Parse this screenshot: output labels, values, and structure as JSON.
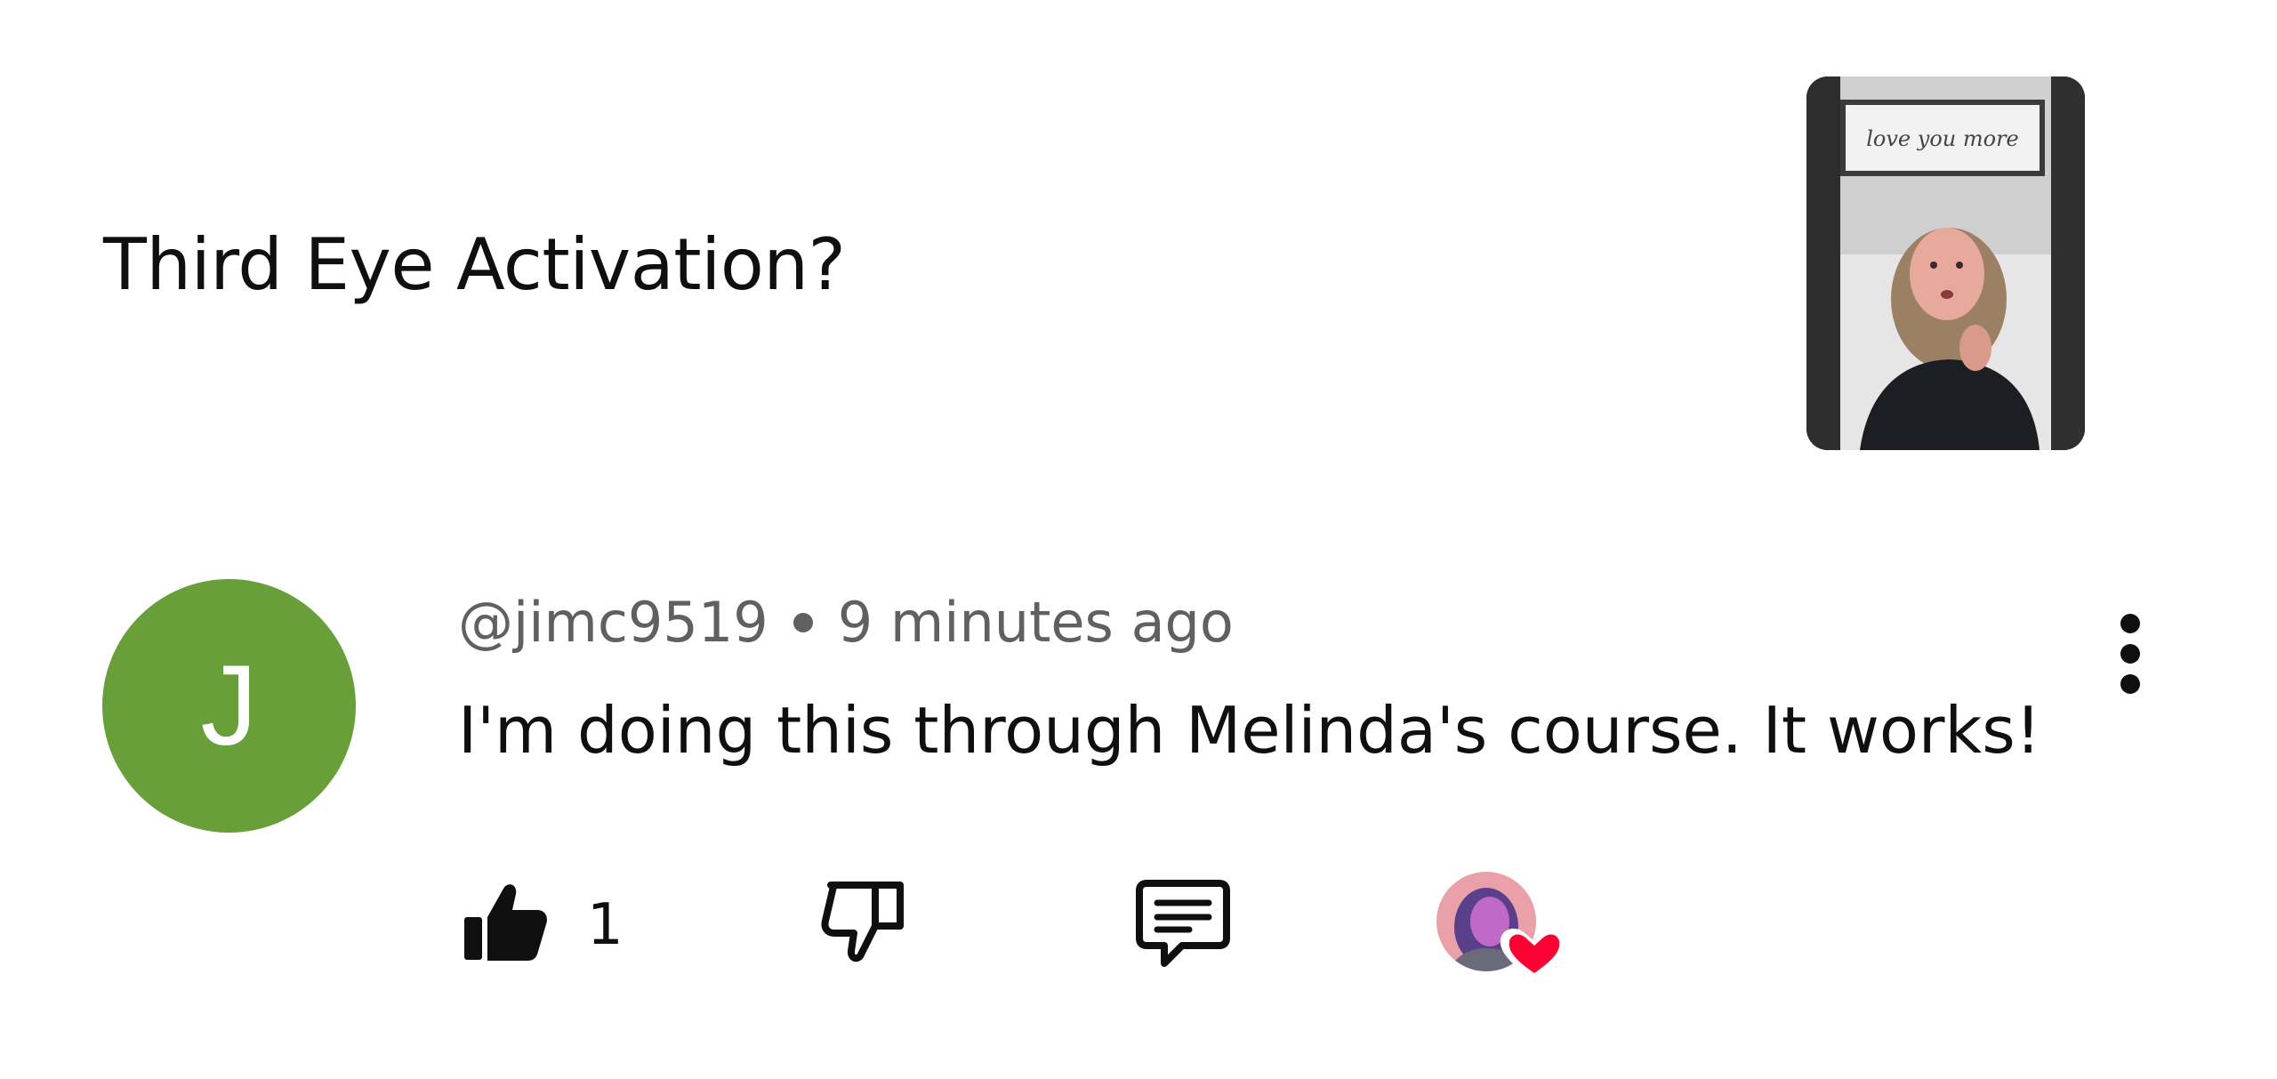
{
  "video": {
    "title": "Third Eye Activation?",
    "thumbnail_sign_text": "love you more"
  },
  "comment": {
    "avatar_letter": "J",
    "avatar_color": "#689f38",
    "author": "@jimc9519",
    "time_ago": "9 minutes ago",
    "text": "I'm doing this through Melinda's course. It works!",
    "like_count": "1"
  },
  "icons": {
    "more": "more-vertical-icon",
    "like": "thumb-up-icon",
    "dislike": "thumb-down-icon",
    "reply": "reply-comment-icon",
    "heart": "creator-heart-icon"
  },
  "colors": {
    "heart": "#ff0033",
    "meta_text": "#606060"
  }
}
